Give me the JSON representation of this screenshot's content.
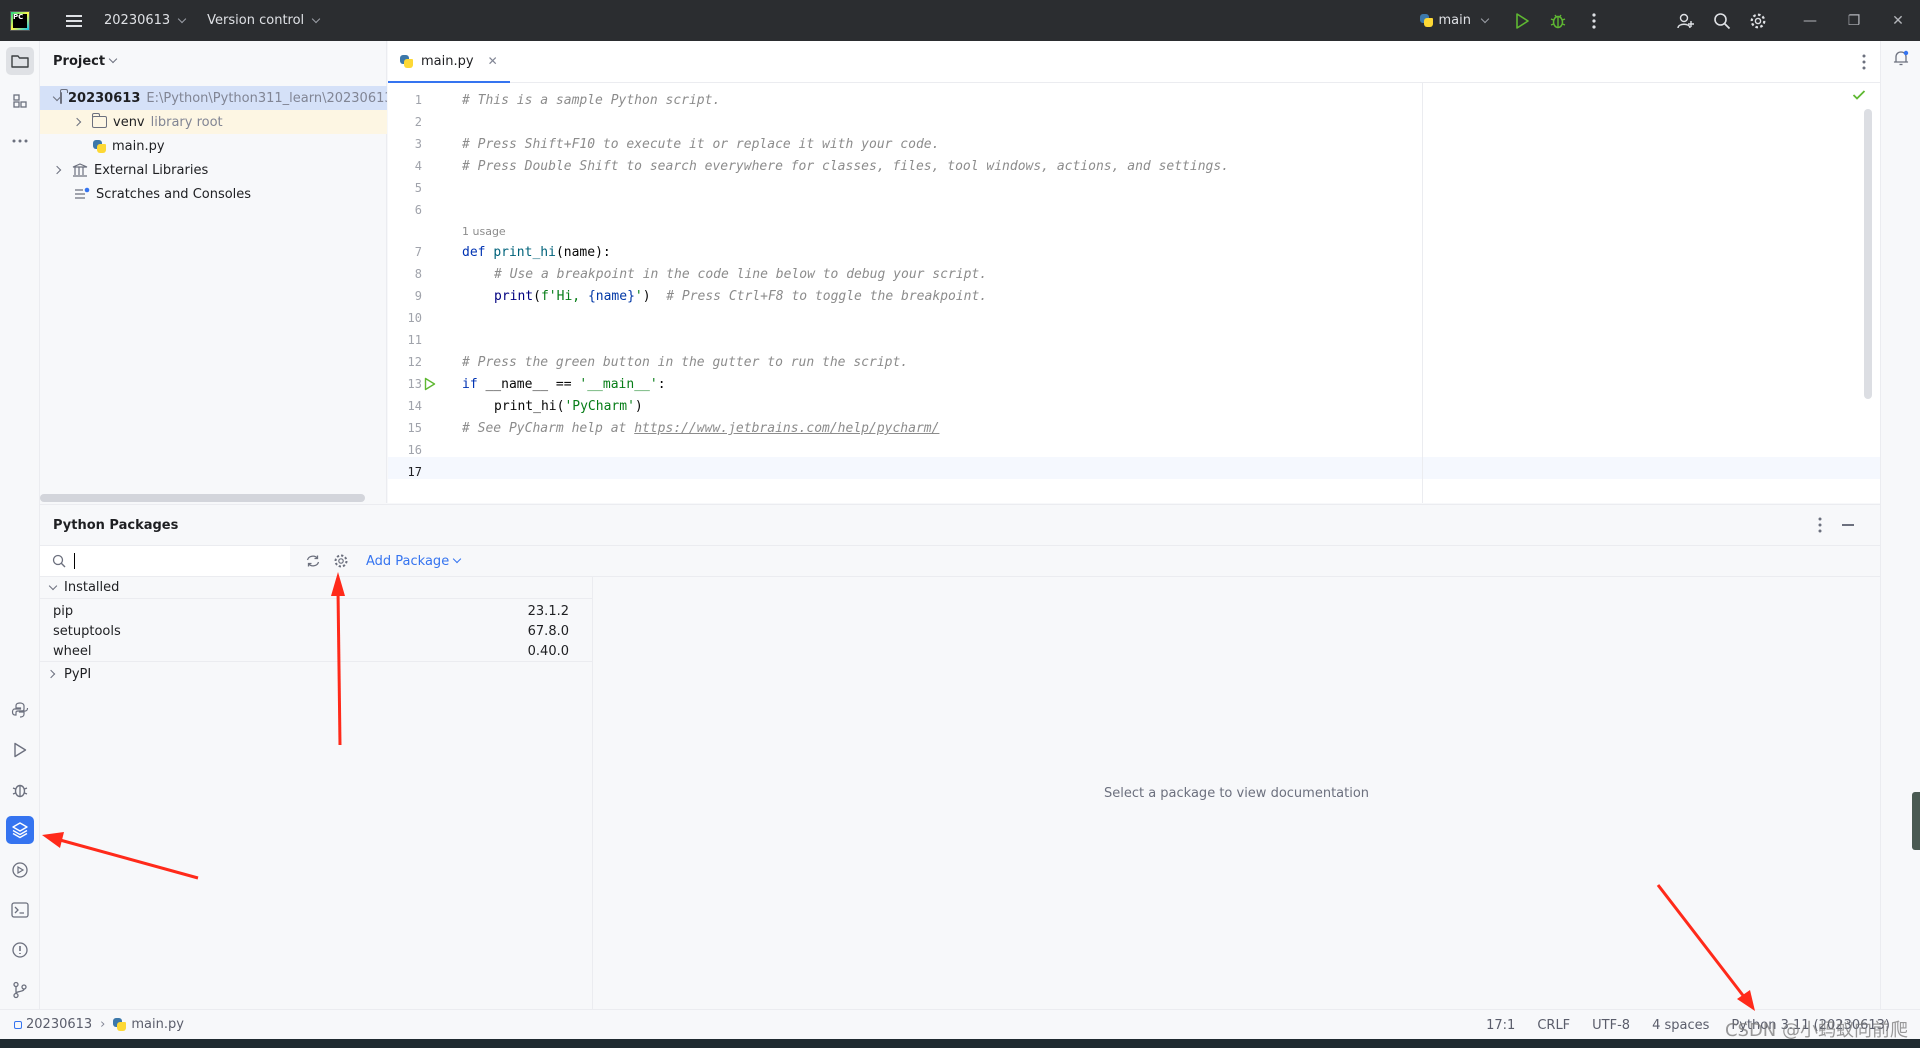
{
  "titlebar": {
    "logo_text": "PC",
    "project_name": "20230613",
    "vcs": "Version control",
    "run_config": "main"
  },
  "project_panel": {
    "title": "Project",
    "tree": [
      {
        "name": "20230613",
        "path": "E:\\Python\\Python311_learn\\20230613"
      },
      {
        "name": "venv",
        "note": "library root"
      },
      {
        "name": "main.py"
      },
      {
        "name": "External Libraries"
      },
      {
        "name": "Scratches and Consoles"
      }
    ]
  },
  "editor": {
    "tab": "main.py",
    "usage_hint": "1 usage",
    "line_numbers": [
      "1",
      "2",
      "3",
      "4",
      "5",
      "6",
      "7",
      "8",
      "9",
      "10",
      "11",
      "12",
      "13",
      "14",
      "15",
      "16",
      "17"
    ],
    "lines": {
      "l1": "# This is a sample Python script.",
      "l3": "# Press Shift+F10 to execute it or replace it with your code.",
      "l4": "# Press Double Shift to search everywhere for classes, files, tool windows, actions, and settings.",
      "l7_kw": "def",
      "l7_fn": "print_hi",
      "l7_rest": "(name):",
      "l8": "# Use a breakpoint in the code line below to debug your script.",
      "l9_fn": "print",
      "l9_open": "(",
      "l9_str1": "f'Hi, ",
      "l9_var": "{name}",
      "l9_str2": "'",
      "l9_close": ")",
      "l9_cmt": "# Press Ctrl+F8 to toggle the breakpoint.",
      "l12": "# Press the green button in the gutter to run the script.",
      "l13_kw": "if",
      "l13_mid": " __name__ == ",
      "l13_str": "'__main__'",
      "l13_end": ":",
      "l14_fn": "print_hi",
      "l14_open": "(",
      "l14_str": "'PyCharm'",
      "l14_close": ")",
      "l16_cmt": "# See PyCharm help at ",
      "l16_link": "https://www.jetbrains.com/help/pycharm/"
    }
  },
  "packages": {
    "title": "Python Packages",
    "add_package": "Add Package",
    "installed_label": "Installed",
    "installed": [
      {
        "name": "pip",
        "version": "23.1.2"
      },
      {
        "name": "setuptools",
        "version": "67.8.0"
      },
      {
        "name": "wheel",
        "version": "0.40.0"
      }
    ],
    "pypi_label": "PyPI",
    "doc_placeholder": "Select a package to view documentation"
  },
  "statusbar": {
    "breadcrumb_project": "20230613",
    "breadcrumb_file": "main.py",
    "position": "17:1",
    "line_sep": "CRLF",
    "encoding": "UTF-8",
    "indent": "4 spaces",
    "interpreter": "Python 3.11 (20230613)"
  },
  "watermark": "CSDN @小蚂蚁向前爬",
  "colors": {
    "accent": "#3574f0",
    "run_green": "#5fb832",
    "annotation_red": "#ff2a1a"
  }
}
